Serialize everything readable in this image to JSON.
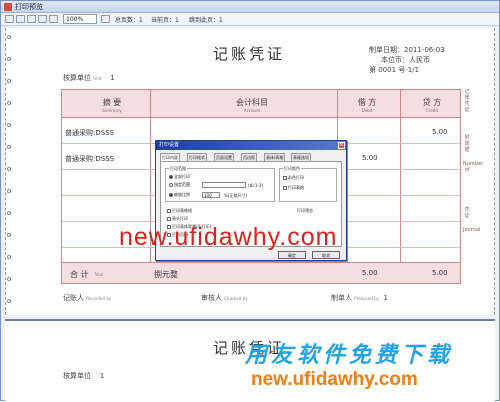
{
  "window": {
    "title": "打印预览"
  },
  "toolbar": {
    "zoom_value": "100%",
    "page_label": "总页数：1",
    "current_label": "当前页：1",
    "jump_label": "跳到此页：1"
  },
  "voucher": {
    "title": "记账凭证",
    "date_label": "制单日期：2011-06-03",
    "currency_label": "本位币：人民币",
    "number_label": "第  0001 号-1/1",
    "org_label": "核算单位",
    "org_sub": "Unit",
    "org_value": "1",
    "headers": {
      "summary": "摘 要",
      "summary_en": "Summary",
      "account": "会计科目",
      "account_en": "Account",
      "debit": "借 方",
      "debit_en": "Debit",
      "credit": "贷 方",
      "credit_en": "Credit"
    },
    "rows": [
      {
        "summary": "普通采购:DSSS",
        "account": "",
        "debit": "",
        "credit": "5.00"
      },
      {
        "summary": "普通采购:DSSS",
        "account": "",
        "debit": "5.00",
        "credit": ""
      },
      {
        "summary": "",
        "account": "",
        "debit": "",
        "credit": ""
      },
      {
        "summary": "",
        "account": "",
        "debit": "",
        "credit": ""
      },
      {
        "summary": "",
        "account": "",
        "debit": "",
        "credit": ""
      }
    ],
    "total_label": "合 计",
    "total_sub": "Total",
    "total_words": "捌元整",
    "total_debit": "5.00",
    "total_credit": "5.00",
    "side_labels": [
      "记账凭证",
      "附单据",
      "Number of",
      "凭证",
      "Journal"
    ],
    "signatures": {
      "booked": "记账人",
      "booked_en": "Recorded by",
      "checked": "审核人",
      "checked_en": "Checked by",
      "made": "制单人",
      "made_en": "Produced by",
      "made_value": "1"
    }
  },
  "voucher2": {
    "title": "记账凭证",
    "org_label": "核算单位",
    "org_value": "1"
  },
  "dialog": {
    "title": "打印设置",
    "tabs": [
      "打印内容",
      "打印格式",
      "页面设置",
      "页边距",
      "表体/表格",
      "表尾选项"
    ],
    "group_range_label": "打印范围",
    "opt_all": "全部打印",
    "opt_range": "指定范围",
    "range_unit": "(如:1-3)",
    "opt_scale": "缩放比例",
    "scale_value": "100",
    "scale_unit": "%(正常尺寸)",
    "group_color_label": "打印颜色",
    "opt_color": "彩色打印",
    "opt_grid": "打印表格",
    "checks": [
      "打印表格线",
      "表头打印",
      "打印表体背景(不打印)",
      "打印页码"
    ],
    "preview_label": "打印预览",
    "ok_label": "确定",
    "cancel_label": "取消"
  },
  "watermark": {
    "url": "new.ufidawhy.com",
    "slogan": "用友软件免费下载",
    "url2": "new.ufidawhy.com"
  }
}
